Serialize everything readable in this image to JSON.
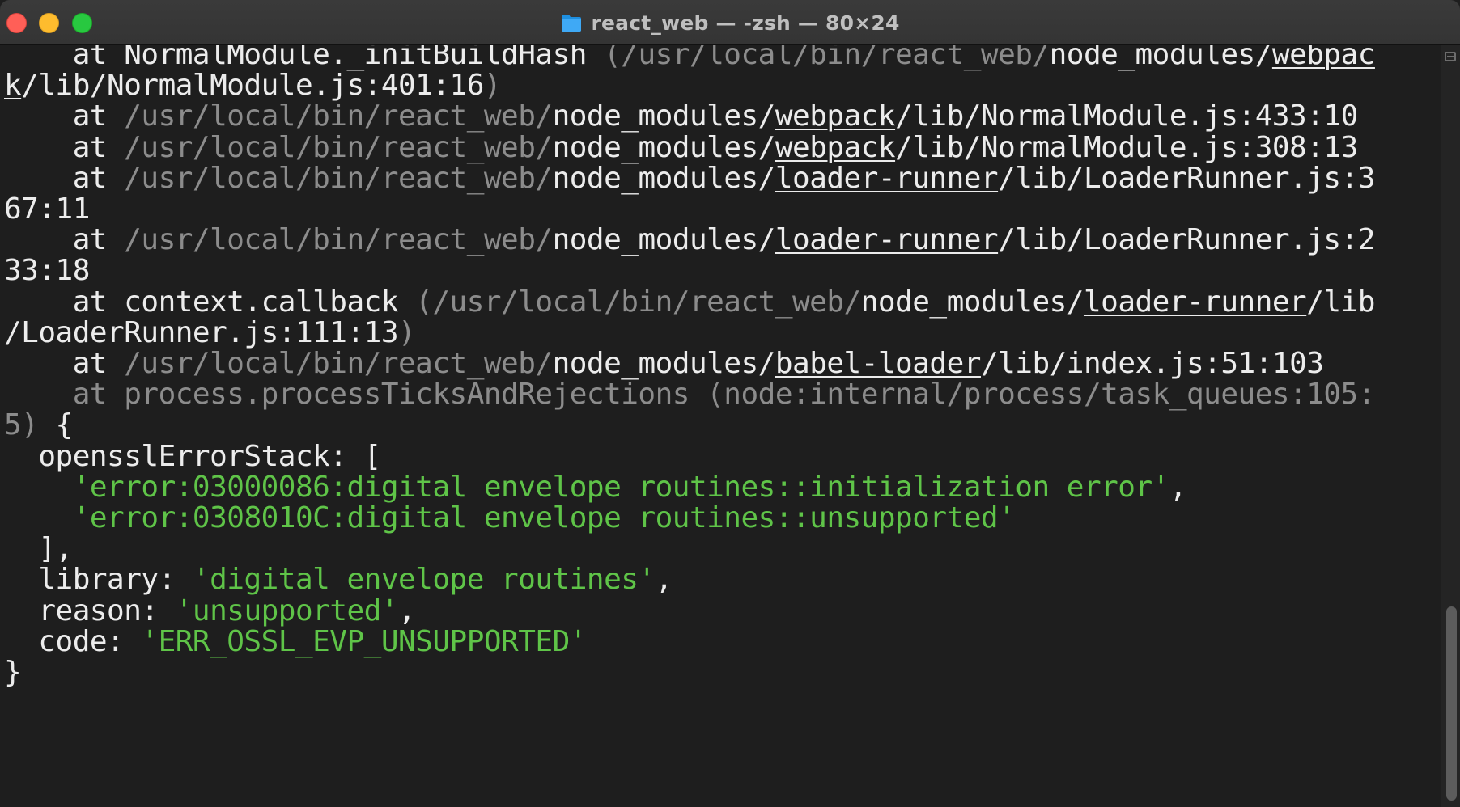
{
  "window": {
    "title": "react_web — -zsh — 80×24",
    "folder_icon": "folder-icon"
  },
  "colors": {
    "background": "#1e1e1e",
    "text": "#ececec",
    "dim": "#8c8c8c",
    "string": "#5fc448"
  },
  "terminal": {
    "lines": [
      [
        {
          "t": "    at NormalModule._initBuildHash "
        },
        {
          "t": "(/usr/local/bin/react_web/",
          "c": "dim"
        },
        {
          "t": "node_modules/"
        },
        {
          "t": "webpac",
          "c": "ul"
        }
      ],
      [
        {
          "t": "k",
          "c": "ul"
        },
        {
          "t": "/lib/NormalModule.js:401:16"
        },
        {
          "t": ")",
          "c": "dim"
        }
      ],
      [
        {
          "t": "    at "
        },
        {
          "t": "/usr/local/bin/react_web/",
          "c": "dim"
        },
        {
          "t": "node_modules/"
        },
        {
          "t": "webpack",
          "c": "ul"
        },
        {
          "t": "/lib/NormalModule.js:433:10"
        }
      ],
      [
        {
          "t": "    at "
        },
        {
          "t": "/usr/local/bin/react_web/",
          "c": "dim"
        },
        {
          "t": "node_modules/"
        },
        {
          "t": "webpack",
          "c": "ul"
        },
        {
          "t": "/lib/NormalModule.js:308:13"
        }
      ],
      [
        {
          "t": "    at "
        },
        {
          "t": "/usr/local/bin/react_web/",
          "c": "dim"
        },
        {
          "t": "node_modules/"
        },
        {
          "t": "loader-runner",
          "c": "ul"
        },
        {
          "t": "/lib/LoaderRunner.js:3"
        }
      ],
      [
        {
          "t": "67:11"
        }
      ],
      [
        {
          "t": "    at "
        },
        {
          "t": "/usr/local/bin/react_web/",
          "c": "dim"
        },
        {
          "t": "node_modules/"
        },
        {
          "t": "loader-runner",
          "c": "ul"
        },
        {
          "t": "/lib/LoaderRunner.js:2"
        }
      ],
      [
        {
          "t": "33:18"
        }
      ],
      [
        {
          "t": "    at context.callback "
        },
        {
          "t": "(/usr/local/bin/react_web/",
          "c": "dim"
        },
        {
          "t": "node_modules/"
        },
        {
          "t": "loader-runner",
          "c": "ul"
        },
        {
          "t": "/lib"
        }
      ],
      [
        {
          "t": "/LoaderRunner.js:111:13"
        },
        {
          "t": ")",
          "c": "dim"
        }
      ],
      [
        {
          "t": "    at "
        },
        {
          "t": "/usr/local/bin/react_web/",
          "c": "dim"
        },
        {
          "t": "node_modules/"
        },
        {
          "t": "babel-loader",
          "c": "ul"
        },
        {
          "t": "/lib/index.js:51:103"
        }
      ],
      [
        {
          "t": "    at process.processTicksAndRejections (node:internal/process/task_queues:105:",
          "c": "dim"
        }
      ],
      [
        {
          "t": "5)",
          "c": "dim"
        },
        {
          "t": " {"
        }
      ],
      [
        {
          "t": "  opensslErrorStack: ["
        }
      ],
      [
        {
          "t": "    "
        },
        {
          "t": "'error:03000086:digital envelope routines::initialization error'",
          "c": "str"
        },
        {
          "t": ","
        }
      ],
      [
        {
          "t": "    "
        },
        {
          "t": "'error:0308010C:digital envelope routines::unsupported'",
          "c": "str"
        }
      ],
      [
        {
          "t": "  ],"
        }
      ],
      [
        {
          "t": "  library: "
        },
        {
          "t": "'digital envelope routines'",
          "c": "str"
        },
        {
          "t": ","
        }
      ],
      [
        {
          "t": "  reason: "
        },
        {
          "t": "'unsupported'",
          "c": "str"
        },
        {
          "t": ","
        }
      ],
      [
        {
          "t": "  code: "
        },
        {
          "t": "'ERR_OSSL_EVP_UNSUPPORTED'",
          "c": "str"
        }
      ],
      [
        {
          "t": "}"
        }
      ]
    ]
  },
  "scrollbar": {
    "position": 0.93
  }
}
